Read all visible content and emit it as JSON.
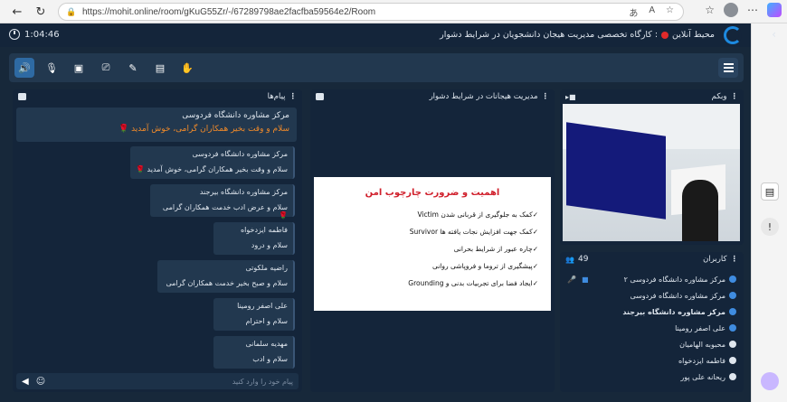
{
  "browser": {
    "url": "https://mohit.online/room/gKuG55Zr/-/67289798ae2facfba59564e2/Room"
  },
  "topbar": {
    "timer": "1:04:46",
    "room_prefix": "محیط آنلاین",
    "room_name": ": کارگاه تخصصی مدیریت هیجان دانشجویان در شرایط دشوار"
  },
  "colors": {
    "accent": "#2e6aa3",
    "record": "#e02a2a",
    "highlight": "#f08a2a"
  },
  "chat": {
    "title": "پیام‌ها",
    "pinned": {
      "sender": "مرکز مشاوره دانشگاه فردوسی",
      "text": "سلام و وقت بخیر همکاران گرامی، خوش آمدید 🌹"
    },
    "messages": [
      {
        "sender": "مرکز مشاوره دانشگاه فردوسی",
        "text": "سلام و وقت بخیر همکاران گرامی، خوش آمدید 🌹"
      },
      {
        "sender": "مرکز مشاوره دانشگاه بیرجند",
        "text": "سلام و عرض ادب خدمت همکاران گرامی🌹"
      },
      {
        "sender": "فاطمه ایزدخواه",
        "text": "سلام و درود"
      },
      {
        "sender": "راضیه ملکوتی",
        "text": "سلام و صبح بخیر خدمت همکاران گرامی"
      },
      {
        "sender": "علی اصفر رومینا",
        "text": "سلام و احترام"
      },
      {
        "sender": "مهدیه سلمانی",
        "text": "سلام و ادب"
      }
    ],
    "input_placeholder": "پیام خود را وارد کنید"
  },
  "presentation": {
    "title": "مدیریت هیجانات در شرایط دشوار",
    "slide_title": "اهمیت و ضرورت چارچوب امن",
    "bullets": [
      "✓کمک به جلوگیری از قربانی شدن Victim",
      "✓کمک جهت افزایش نجات یافته ها Survivor",
      "✓چاره عبور از شرایط بحرانی",
      "✓پیشگیری از تروما و فروپاشی روانی",
      "✓ایجاد فضا برای تجربیات بدنی و Grounding"
    ]
  },
  "webcam": {
    "title": "وبکم"
  },
  "users": {
    "title": "کاربران",
    "count": "49",
    "list": [
      {
        "name": "مرکز مشاوره دانشگاه فردوسی ۲",
        "bold": false
      },
      {
        "name": "مرکز مشاوره دانشگاه فردوسی",
        "bold": false
      },
      {
        "name": "مرکز مشاوره دانشگاه بیرجند",
        "bold": true
      },
      {
        "name": "علی اصفر رومینا",
        "bold": false
      },
      {
        "name": "محبوبه الهامیان",
        "bold": false
      },
      {
        "name": "فاطمه ایزدخواه",
        "bold": false
      },
      {
        "name": "ریحانه علی پور",
        "bold": false
      }
    ]
  }
}
